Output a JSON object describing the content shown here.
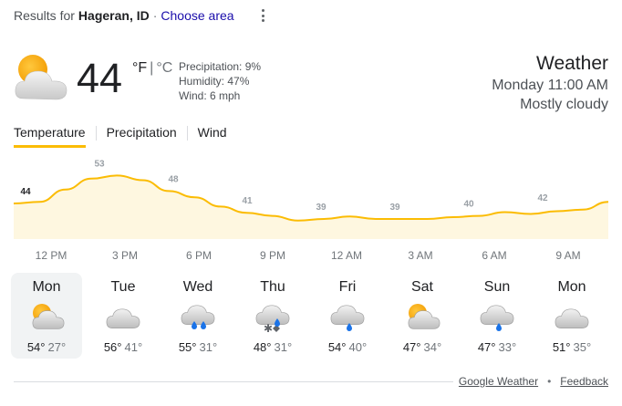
{
  "header": {
    "results_prefix": "Results for",
    "location": "Hageran, ID",
    "separator": "·",
    "choose_area": "Choose area"
  },
  "current": {
    "icon": "partly-cloudy-icon",
    "temperature": "44",
    "unit_f": "°F",
    "unit_sep": "|",
    "unit_c": "°C",
    "precipitation": "Precipitation: 9%",
    "humidity": "Humidity: 47%",
    "wind": "Wind: 6 mph"
  },
  "summary": {
    "title": "Weather",
    "datetime": "Monday 11:00 AM",
    "condition": "Mostly cloudy"
  },
  "tabs": [
    {
      "label": "Temperature",
      "active": true
    },
    {
      "label": "Precipitation",
      "active": false
    },
    {
      "label": "Wind",
      "active": false
    }
  ],
  "chart_data": {
    "type": "area",
    "x": [
      "12 PM",
      "3 PM",
      "6 PM",
      "9 PM",
      "12 AM",
      "3 AM",
      "6 AM",
      "9 AM"
    ],
    "values": [
      44,
      53,
      48,
      41,
      39,
      39,
      40,
      42
    ],
    "smooth_values": [
      44,
      44.5,
      48.5,
      52,
      53,
      51.5,
      48,
      46,
      43,
      41,
      40,
      38.5,
      39,
      39.8,
      39,
      39,
      39,
      39.6,
      40,
      41.2,
      40.6,
      41.5,
      42,
      44.5
    ],
    "fill_color": "#fef7e0",
    "line_color": "#fbbc04"
  },
  "times": [
    "12 PM",
    "3 PM",
    "6 PM",
    "9 PM",
    "12 AM",
    "3 AM",
    "6 AM",
    "9 AM"
  ],
  "days": [
    {
      "name": "Mon",
      "icon": "partly-cloudy-icon",
      "hi": "54°",
      "lo": "27°",
      "selected": true
    },
    {
      "name": "Tue",
      "icon": "cloudy-icon",
      "hi": "56°",
      "lo": "41°",
      "selected": false
    },
    {
      "name": "Wed",
      "icon": "rain-icon",
      "hi": "55°",
      "lo": "31°",
      "selected": false
    },
    {
      "name": "Thu",
      "icon": "rain-snow-icon",
      "hi": "48°",
      "lo": "31°",
      "selected": false
    },
    {
      "name": "Fri",
      "icon": "light-rain-icon",
      "hi": "54°",
      "lo": "40°",
      "selected": false
    },
    {
      "name": "Sat",
      "icon": "partly-cloudy-icon",
      "hi": "47°",
      "lo": "34°",
      "selected": false
    },
    {
      "name": "Sun",
      "icon": "light-rain-icon",
      "hi": "47°",
      "lo": "33°",
      "selected": false
    },
    {
      "name": "Mon",
      "icon": "cloudy-icon",
      "hi": "51°",
      "lo": "35°",
      "selected": false
    }
  ],
  "footer": {
    "source": "Google Weather",
    "dot": "•",
    "feedback": "Feedback"
  },
  "colors": {
    "accent": "#fbbc04",
    "link": "#1a0dab",
    "rain": "#1a73e8"
  }
}
